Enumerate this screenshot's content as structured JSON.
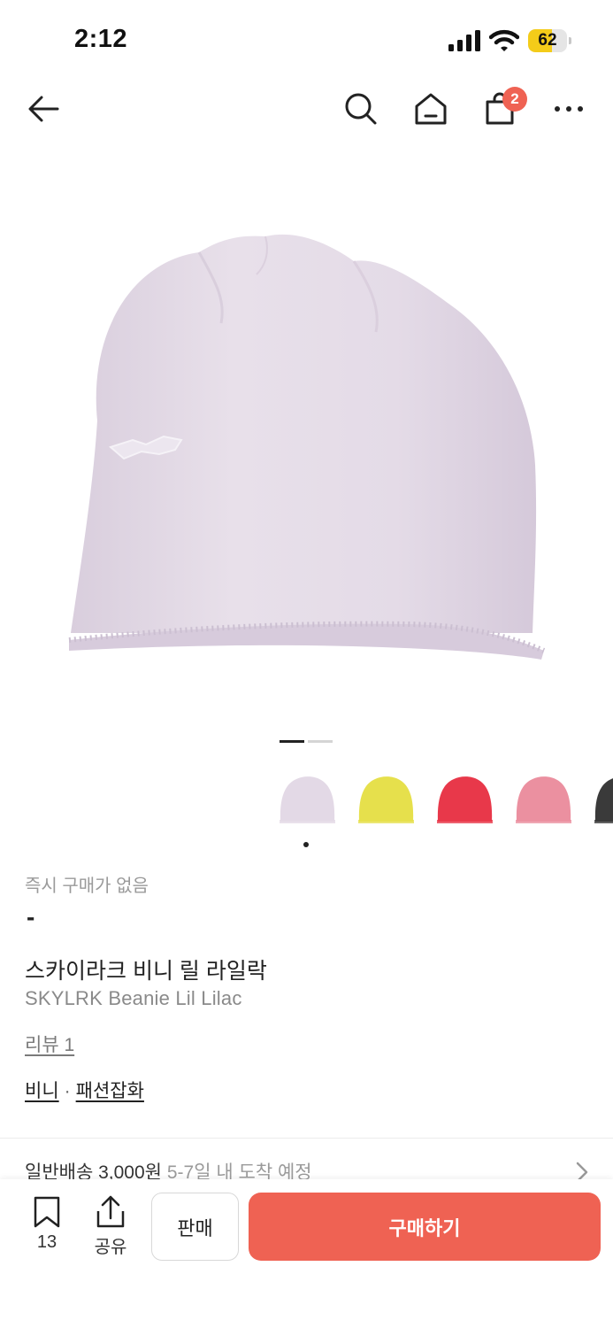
{
  "status_bar": {
    "time": "2:12",
    "battery_level": "62",
    "battery_fraction": 0.62,
    "battery_color": "#f4cc19"
  },
  "nav": {
    "back_icon": "arrow-left-icon",
    "search_icon": "search-icon",
    "home_icon": "home-icon",
    "cart_icon": "shopping-bag-icon",
    "cart_badge": "2",
    "more_icon": "more-horizontal-icon"
  },
  "product": {
    "image": "lilac-beanie-photo",
    "image_count": 2,
    "current_image": 1,
    "price_caption": "즉시 구매가 없음",
    "price_value": "-",
    "name_ko": "스카이라크 비니 릴 라일락",
    "name_en": "SKYLRK Beanie Lil Lilac",
    "review_link": "리뷰 1",
    "category_1": "비니",
    "category_sep": "·",
    "category_2": "패션잡화",
    "shipping_label": "일반배송 3,000원",
    "shipping_eta": "5-7일 내 도착 예정",
    "swatches": [
      {
        "name": "lilac",
        "color": "#e3d9e6"
      },
      {
        "name": "yellow",
        "color": "#e6e04c"
      },
      {
        "name": "red",
        "color": "#e8384a"
      },
      {
        "name": "pink",
        "color": "#eb90a0"
      },
      {
        "name": "black",
        "color": "#3a3a3a"
      }
    ],
    "selected_swatch": 0
  },
  "bottom_bar": {
    "bookmark_count": "13",
    "share_label": "공유",
    "sell_label": "판매",
    "buy_label": "구매하기"
  },
  "colors": {
    "accent": "#ef6253",
    "hat_main": "#e5dce8",
    "hat_shadow": "#d3c6d8"
  }
}
